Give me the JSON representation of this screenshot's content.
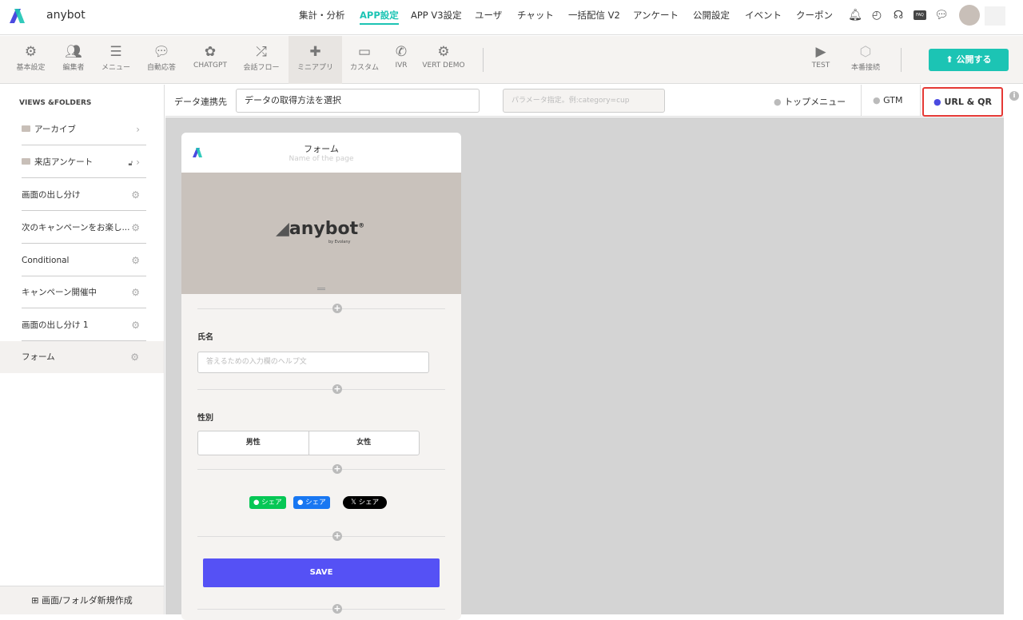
{
  "header": {
    "app_name": "anybot",
    "nav": [
      "集計・分析",
      "APP設定",
      "APP V3設定",
      "ユーザ",
      "チャット",
      "一括配信 V2",
      "アンケート",
      "公開設定",
      "イベント",
      "クーポン"
    ],
    "active_nav": "APP設定",
    "faq_label": "FAQ"
  },
  "toolbar": {
    "tools": [
      {
        "label": "基本設定",
        "icon": "gear-icon"
      },
      {
        "label": "編集者",
        "icon": "users-icon"
      },
      {
        "label": "メニュー",
        "icon": "list-icon"
      },
      {
        "label": "自動応答",
        "icon": "chat-icon"
      },
      {
        "label": "CHATGPT",
        "icon": "openai-icon"
      },
      {
        "label": "会話フロー",
        "icon": "shuffle-icon"
      },
      {
        "label": "ミニアプリ",
        "icon": "puzzle-icon"
      },
      {
        "label": "カスタム",
        "icon": "monitor-icon"
      },
      {
        "label": "IVR",
        "icon": "phone-icon"
      },
      {
        "label": "VERT DEMO",
        "icon": "gear-icon"
      }
    ],
    "test_label": "TEST",
    "production_label": "本番接続",
    "publish_label": "公開する"
  },
  "sidebar": {
    "heading": "VIEWS &FOLDERS",
    "items": [
      {
        "label": "アーカイブ",
        "type": "folder"
      },
      {
        "label": "来店アンケート",
        "type": "folder"
      },
      {
        "label": "画面の出し分け"
      },
      {
        "label": "次のキャンペーンをお楽し..."
      },
      {
        "label": "Conditional"
      },
      {
        "label": "キャンペーン開催中"
      },
      {
        "label": "画面の出し分け 1"
      },
      {
        "label": "フォーム",
        "selected": true
      }
    ],
    "new_button": "画面/フォルダ新規作成"
  },
  "subbar": {
    "data_label": "データ連携先",
    "data_select": "データの取得方法を選択",
    "param_placeholder": "パラメータ指定。例:category=cup",
    "top_menu": "トップメニュー",
    "gtm": "GTM",
    "url_qr": "URL & QR"
  },
  "page": {
    "title": "フォーム",
    "subtitle": "Name of the page",
    "banner_brand": "anybot",
    "banner_sub": "by Evolany",
    "name_label": "氏名",
    "name_placeholder": "答えるための入力欄のヘルプ文",
    "gender_label": "性別",
    "options": [
      "男性",
      "女性"
    ],
    "share": {
      "line": "シェア",
      "facebook": "シェア",
      "x": "シェア"
    },
    "save": "SAVE"
  },
  "colors": {
    "accent": "#1cc4b4",
    "save": "#5551f5",
    "highlight": "#e53935"
  }
}
